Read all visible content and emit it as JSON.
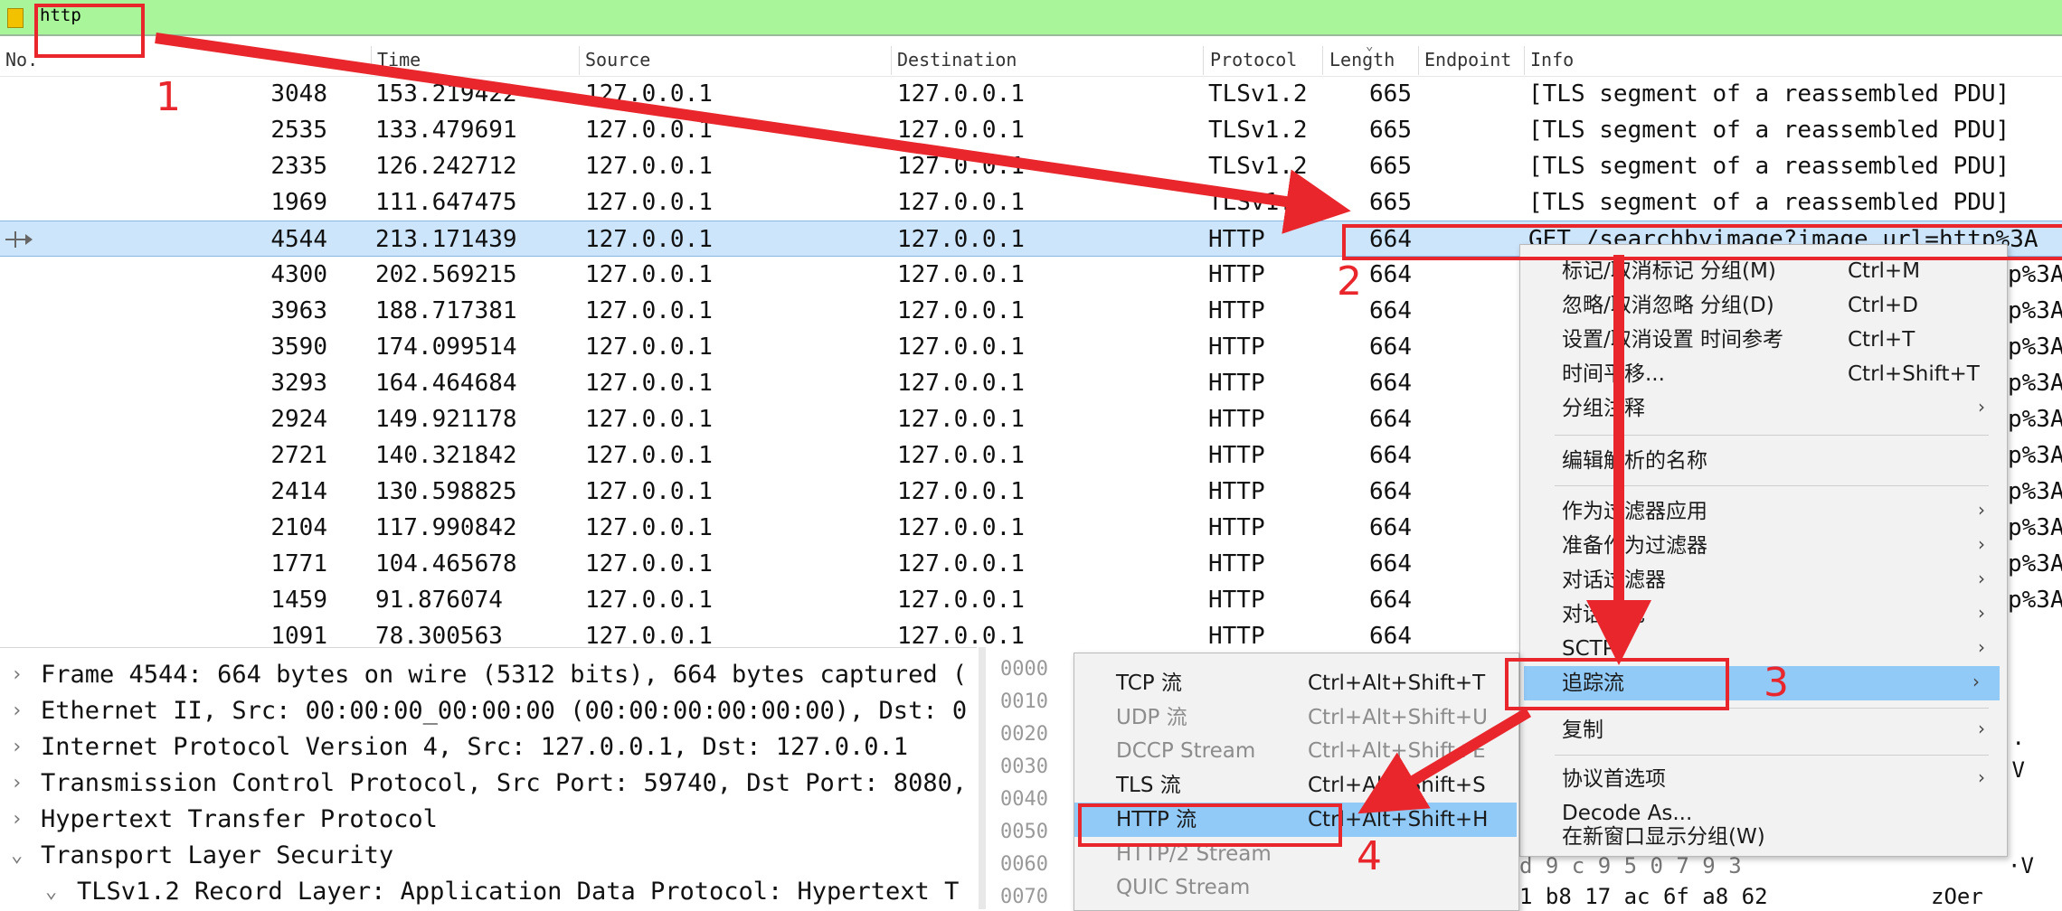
{
  "filter": {
    "text": "http"
  },
  "columns": [
    "No.",
    "Time",
    "Source",
    "Destination",
    "Protocol",
    "Length",
    "Endpoint",
    "Info"
  ],
  "packets": [
    {
      "no": "3048",
      "time": "153.219422",
      "src": "127.0.0.1",
      "dst": "127.0.0.1",
      "proto": "TLSv1.2",
      "len": "665",
      "info": "[TLS segment of a reassembled PDU]"
    },
    {
      "no": "2535",
      "time": "133.479691",
      "src": "127.0.0.1",
      "dst": "127.0.0.1",
      "proto": "TLSv1.2",
      "len": "665",
      "info": "[TLS segment of a reassembled PDU]"
    },
    {
      "no": "2335",
      "time": "126.242712",
      "src": "127.0.0.1",
      "dst": "127.0.0.1",
      "proto": "TLSv1.2",
      "len": "665",
      "info": "[TLS segment of a reassembled PDU]"
    },
    {
      "no": "1969",
      "time": "111.647475",
      "src": "127.0.0.1",
      "dst": "127.0.0.1",
      "proto": "TLSv1.2",
      "len": "665",
      "info": "[TLS segment of a reassembled PDU]"
    },
    {
      "no": "4544",
      "time": "213.171439",
      "src": "127.0.0.1",
      "dst": "127.0.0.1",
      "proto": "HTTP",
      "len": "664",
      "info": "GET /searchbyimage?image_url=http%3A"
    },
    {
      "no": "4300",
      "time": "202.569215",
      "src": "127.0.0.1",
      "dst": "127.0.0.1",
      "proto": "HTTP",
      "len": "664",
      "info": "p%3A"
    },
    {
      "no": "3963",
      "time": "188.717381",
      "src": "127.0.0.1",
      "dst": "127.0.0.1",
      "proto": "HTTP",
      "len": "664",
      "info": "p%3A"
    },
    {
      "no": "3590",
      "time": "174.099514",
      "src": "127.0.0.1",
      "dst": "127.0.0.1",
      "proto": "HTTP",
      "len": "664",
      "info": "p%3A"
    },
    {
      "no": "3293",
      "time": "164.464684",
      "src": "127.0.0.1",
      "dst": "127.0.0.1",
      "proto": "HTTP",
      "len": "664",
      "info": "p%3A"
    },
    {
      "no": "2924",
      "time": "149.921178",
      "src": "127.0.0.1",
      "dst": "127.0.0.1",
      "proto": "HTTP",
      "len": "664",
      "info": "p%3A"
    },
    {
      "no": "2721",
      "time": "140.321842",
      "src": "127.0.0.1",
      "dst": "127.0.0.1",
      "proto": "HTTP",
      "len": "664",
      "info": "p%3A"
    },
    {
      "no": "2414",
      "time": "130.598825",
      "src": "127.0.0.1",
      "dst": "127.0.0.1",
      "proto": "HTTP",
      "len": "664",
      "info": "p%3A"
    },
    {
      "no": "2104",
      "time": "117.990842",
      "src": "127.0.0.1",
      "dst": "127.0.0.1",
      "proto": "HTTP",
      "len": "664",
      "info": "p%3A"
    },
    {
      "no": "1771",
      "time": "104.465678",
      "src": "127.0.0.1",
      "dst": "127.0.0.1",
      "proto": "HTTP",
      "len": "664",
      "info": "p%3A"
    },
    {
      "no": "1459",
      "time": "91.876074",
      "src": "127.0.0.1",
      "dst": "127.0.0.1",
      "proto": "HTTP",
      "len": "664",
      "info": "p%3A"
    },
    {
      "no": "1091",
      "time": "78.300563",
      "src": "127.0.0.1",
      "dst": "127.0.0.1",
      "proto": "HTTP",
      "len": "664",
      "info": ""
    }
  ],
  "details": [
    {
      "exp": "›",
      "text": "Frame 4544: 664 bytes on wire (5312 bits), 664 bytes captured ("
    },
    {
      "exp": "›",
      "text": "Ethernet II, Src: 00:00:00_00:00:00 (00:00:00:00:00:00), Dst: 0"
    },
    {
      "exp": "›",
      "text": "Internet Protocol Version 4, Src: 127.0.0.1, Dst: 127.0.0.1"
    },
    {
      "exp": "›",
      "text": "Transmission Control Protocol, Src Port: 59740, Dst Port: 8080,"
    },
    {
      "exp": "›",
      "text": "Hypertext Transfer Protocol"
    },
    {
      "exp": "⌄",
      "text": "Transport Layer Security"
    },
    {
      "exp": "⌄",
      "text": "TLSv1.2 Record Layer: Application Data Protocol: Hypertext T"
    }
  ],
  "bytes": {
    "offsets": [
      "0000",
      "0010",
      "0020",
      "0030",
      "0040",
      "0050",
      "0060",
      "0070"
    ],
    "hex_tail": "1 b8 17 ac 6f a8 62",
    "ascii_tail": "zOer",
    "partial_hex": "d 9 c 9 5 0 7 9 3",
    "right_chars": [
      ",.",
      "·V",
      "",
      "",
      "",
      "",
      "·V",
      "zOer"
    ]
  },
  "context_menu": [
    {
      "label": "标记/取消标记 分组(M)",
      "shortcut": "Ctrl+M",
      "arrow": ""
    },
    {
      "label": "忽略/取消忽略 分组(D)",
      "shortcut": "Ctrl+D",
      "arrow": ""
    },
    {
      "label": "设置/取消设置 时间参考",
      "shortcut": "Ctrl+T",
      "arrow": ""
    },
    {
      "label": "时间平移...",
      "shortcut": "Ctrl+Shift+T",
      "arrow": ""
    },
    {
      "label": "分组注释",
      "shortcut": "",
      "arrow": "›"
    },
    {
      "label": "编辑解析的名称",
      "shortcut": "",
      "arrow": ""
    },
    {
      "label": "作为过滤器应用",
      "shortcut": "",
      "arrow": "›"
    },
    {
      "label": "准备作为过滤器",
      "shortcut": "",
      "arrow": "›"
    },
    {
      "label": "对话过滤器",
      "shortcut": "",
      "arrow": "›"
    },
    {
      "label": "对话着色",
      "shortcut": "",
      "arrow": "›"
    },
    {
      "label": "SCTP",
      "shortcut": "",
      "arrow": "›"
    },
    {
      "label": "追踪流",
      "shortcut": "",
      "arrow": "›"
    },
    {
      "label": "复制",
      "shortcut": "",
      "arrow": "›"
    },
    {
      "label": "协议首选项",
      "shortcut": "",
      "arrow": "›"
    },
    {
      "label": "Decode As...",
      "shortcut": "",
      "arrow": ""
    },
    {
      "label": "在新窗口显示分组(W)",
      "shortcut": "",
      "arrow": ""
    }
  ],
  "stream_submenu": [
    {
      "label": "TCP 流",
      "shortcut": "Ctrl+Alt+Shift+T",
      "disabled": false
    },
    {
      "label": "UDP 流",
      "shortcut": "Ctrl+Alt+Shift+U",
      "disabled": true
    },
    {
      "label": "DCCP Stream",
      "shortcut": "Ctrl+Alt+Shift+E",
      "disabled": true
    },
    {
      "label": "TLS 流",
      "shortcut": "Ctrl+Alt+Shift+S",
      "disabled": false
    },
    {
      "label": "HTTP 流",
      "shortcut": "Ctrl+Alt+Shift+H",
      "disabled": false
    },
    {
      "label": "HTTP/2 Stream",
      "shortcut": "",
      "disabled": true
    },
    {
      "label": "QUIC Stream",
      "shortcut": "",
      "disabled": true
    }
  ],
  "annotations": {
    "step1": "1",
    "step2": "2",
    "step3": "3",
    "step4": "4"
  },
  "colors": {
    "filter_ok": "#a8f59a",
    "selected_row": "#cde5fb",
    "menu_highlight": "#91c9f7",
    "annotation_red": "#e8262c"
  }
}
